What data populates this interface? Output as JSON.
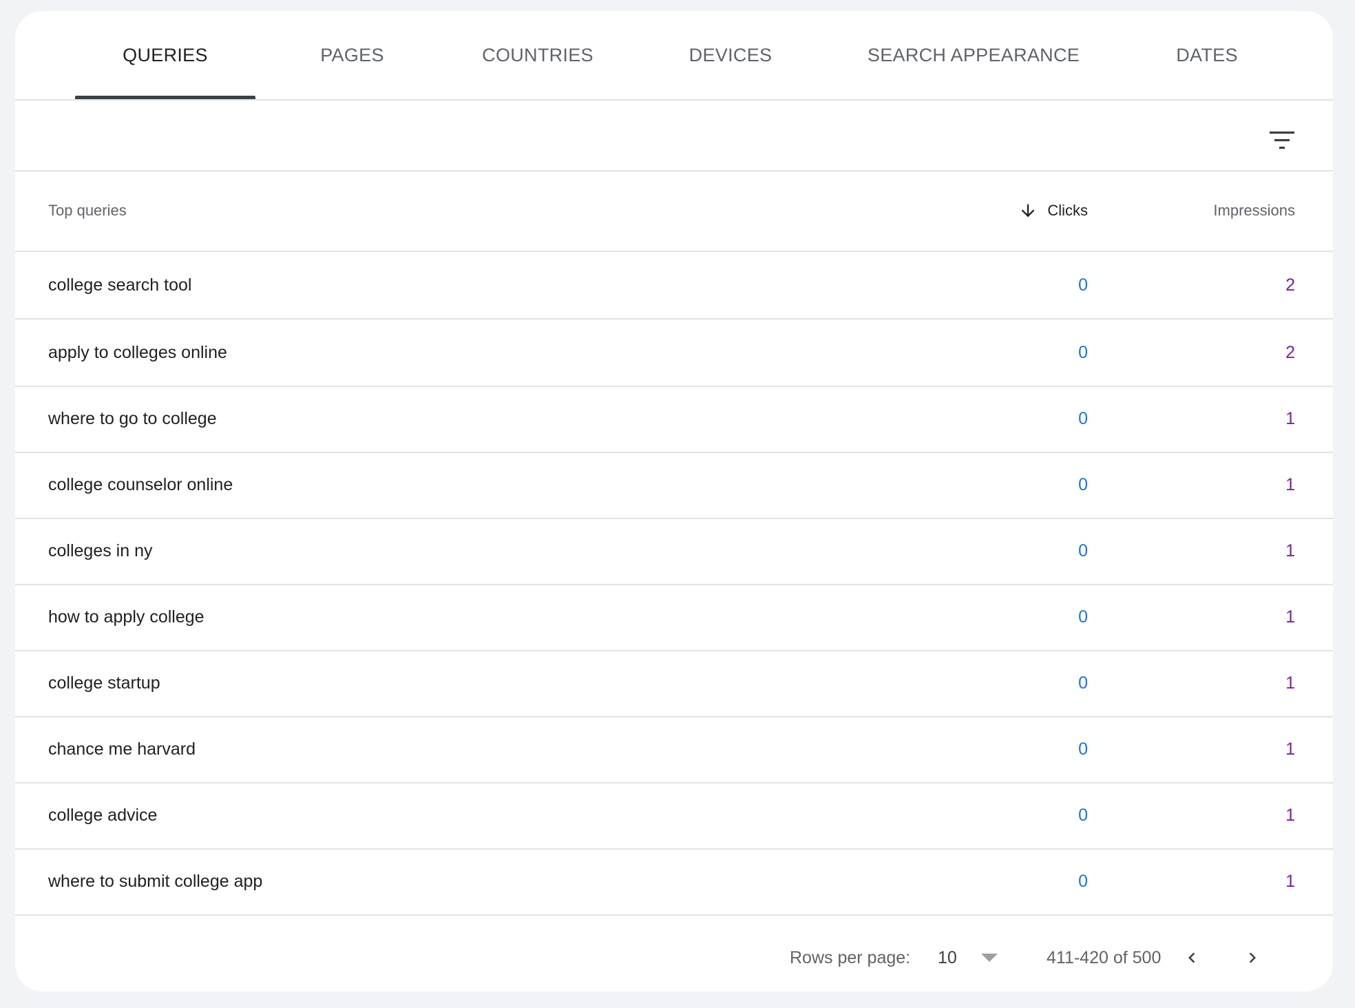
{
  "tabs": [
    {
      "label": "QUERIES",
      "active": true
    },
    {
      "label": "PAGES",
      "active": false
    },
    {
      "label": "COUNTRIES",
      "active": false
    },
    {
      "label": "DEVICES",
      "active": false
    },
    {
      "label": "SEARCH APPEARANCE",
      "active": false
    },
    {
      "label": "DATES",
      "active": false
    }
  ],
  "toolbar": {
    "filter_icon": "filter-list-icon"
  },
  "table": {
    "headers": {
      "query": "Top queries",
      "clicks": "Clicks",
      "impressions": "Impressions",
      "sort_icon": "arrow-downward-icon"
    },
    "rows": [
      {
        "query": "college search tool",
        "clicks": "0",
        "impressions": "2"
      },
      {
        "query": "apply to colleges online",
        "clicks": "0",
        "impressions": "2"
      },
      {
        "query": "where to go to college",
        "clicks": "0",
        "impressions": "1"
      },
      {
        "query": "college counselor online",
        "clicks": "0",
        "impressions": "1"
      },
      {
        "query": "colleges in ny",
        "clicks": "0",
        "impressions": "1"
      },
      {
        "query": "how to apply college",
        "clicks": "0",
        "impressions": "1"
      },
      {
        "query": "college startup",
        "clicks": "0",
        "impressions": "1"
      },
      {
        "query": "chance me harvard",
        "clicks": "0",
        "impressions": "1"
      },
      {
        "query": "college advice",
        "clicks": "0",
        "impressions": "1"
      },
      {
        "query": "where to submit college app",
        "clicks": "0",
        "impressions": "1"
      }
    ]
  },
  "pagination": {
    "rows_per_page_label": "Rows per page:",
    "rows_per_page_value": "10",
    "range": "411-420 of 500",
    "prev_icon": "chevron-left-icon",
    "next_icon": "chevron-right-icon",
    "dropdown_icon": "arrow-drop-down-icon"
  },
  "colors": {
    "clicks": "#1a73e8",
    "impressions": "#7b1fa2",
    "active_tab_indicator": "#3c4043"
  }
}
